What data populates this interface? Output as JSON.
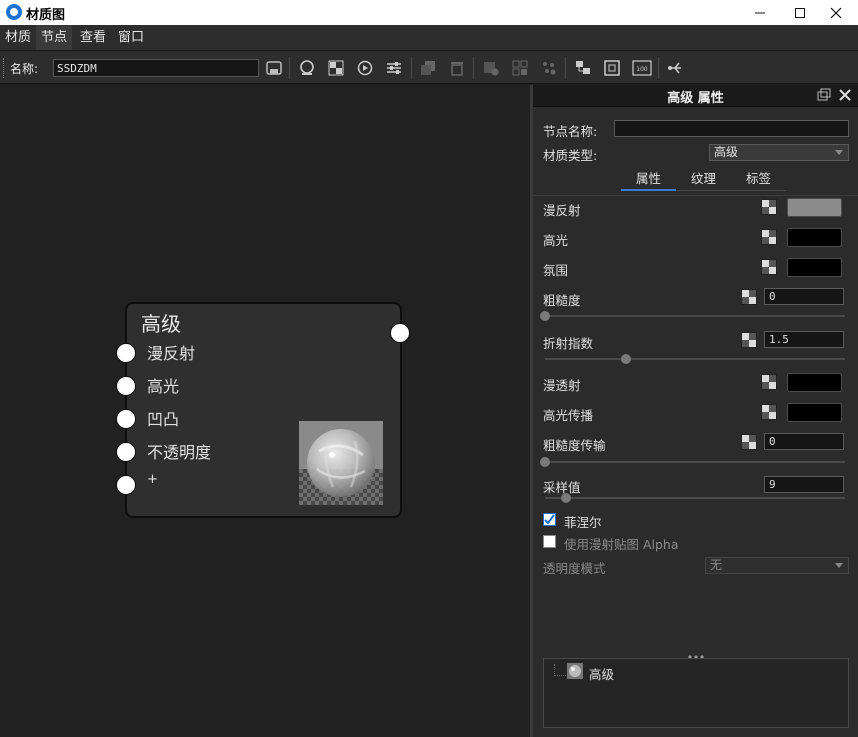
{
  "window": {
    "title": "材质图"
  },
  "menu": [
    "材质",
    "节点",
    "查看",
    "窗口"
  ],
  "toolbar": {
    "name_label": "名称:",
    "name_value": "SSDZDM"
  },
  "node": {
    "title": "高级",
    "inputs": [
      "漫反射",
      "高光",
      "凹凸",
      "不透明度",
      "+"
    ]
  },
  "panel": {
    "title": "高级 属性",
    "node_name_label": "节点名称:",
    "node_name_value": "",
    "material_type_label": "材质类型:",
    "material_type_value": "高级",
    "tabs": [
      "属性",
      "纹理",
      "标签"
    ],
    "diffuse_label": "漫反射",
    "specular_label": "高光",
    "ambient_label": "氛围",
    "roughness_label": "粗糙度",
    "roughness_value": "0",
    "ior_label": "折射指数",
    "ior_value": "1.5",
    "transmission_label": "漫透射",
    "spec_trans_label": "高光传播",
    "rough_trans_label": "粗糙度传输",
    "rough_trans_value": "0",
    "samples_label": "采样值",
    "samples_value": "9",
    "fresnel_label": "菲涅尔",
    "alpha_label": "使用漫射贴图 Alpha",
    "opacity_mode_label": "透明度模式",
    "opacity_mode_value": "无",
    "tree_item": "高级"
  },
  "colors": {
    "diffuse": "#8c8c8c",
    "specular": "#000000",
    "ambient": "#000000",
    "transmission": "#000000",
    "spec_trans": "#000000",
    "accent": "#1e6fd0"
  },
  "sliders": {
    "roughness": 0.0,
    "ior_fraction": 0.27,
    "rough_trans": 0.0,
    "samples_fraction": 0.07
  }
}
